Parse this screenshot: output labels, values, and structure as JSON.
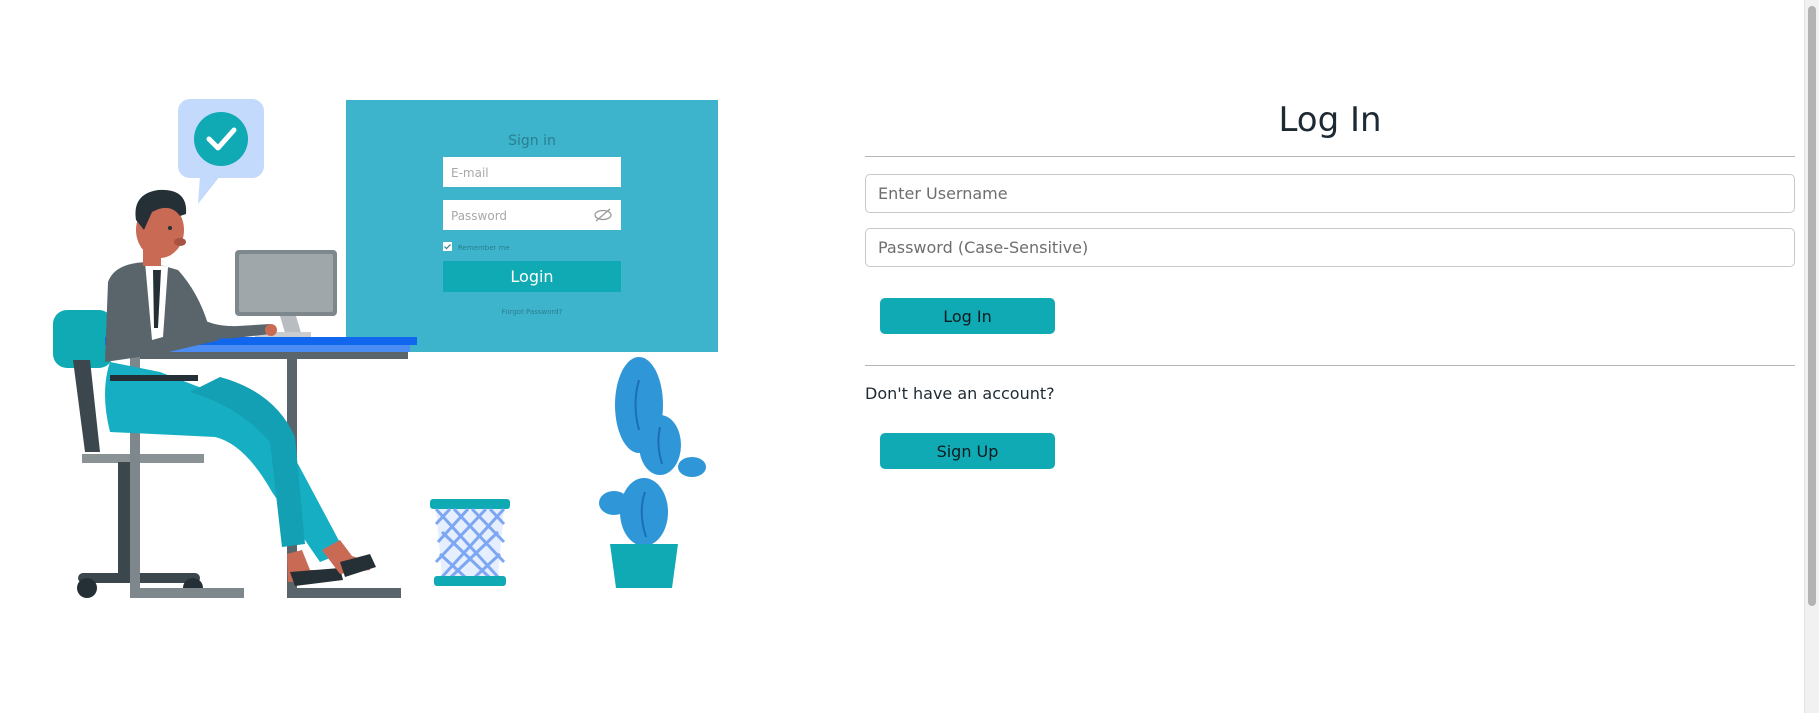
{
  "login": {
    "title": "Log In",
    "username_placeholder": "Enter Username",
    "password_placeholder": "Password (Case-Sensitive)",
    "login_button": "Log In",
    "no_account_text": "Don't have an account?",
    "signup_button": "Sign Up"
  },
  "illustration": {
    "screen_title": "Sign in",
    "email_placeholder": "E-mail",
    "password_placeholder": "Password",
    "remember_label": "Remember me",
    "login_label": "Login",
    "forgot_label": "Forgot Password?",
    "check_icon": "check-icon",
    "eye_icon": "eye-slash-icon"
  },
  "colors": {
    "accent": "#0faab4",
    "screen": "#3db4cc",
    "cactus": "#2f96d8",
    "desk": "#1166ee"
  }
}
